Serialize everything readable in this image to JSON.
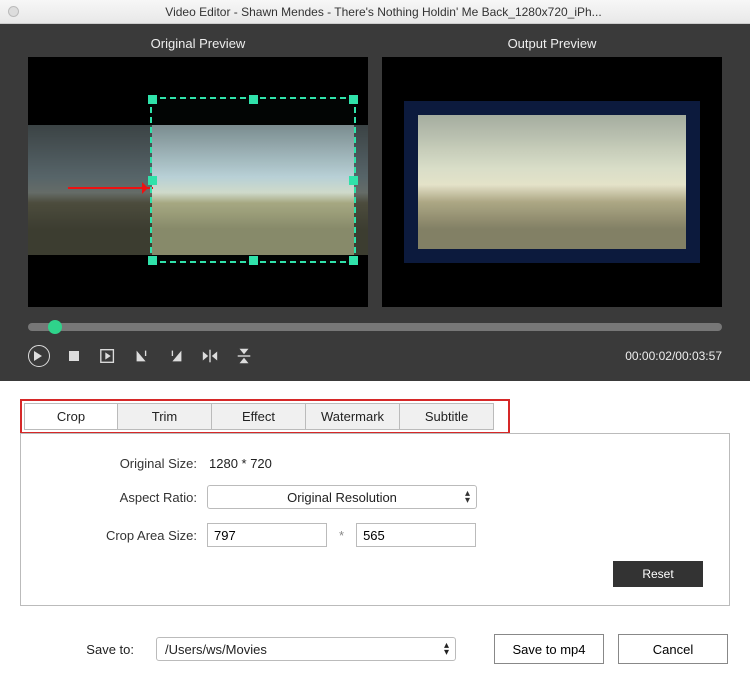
{
  "titlebar": {
    "title": "Video Editor - Shawn Mendes - There's Nothing Holdin' Me Back_1280x720_iPh..."
  },
  "preview": {
    "original_label": "Original Preview",
    "output_label": "Output Preview"
  },
  "playback": {
    "current": "00:00:02",
    "total": "00:03:57",
    "sep": "/"
  },
  "tabs": {
    "items": [
      "Crop",
      "Trim",
      "Effect",
      "Watermark",
      "Subtitle"
    ],
    "active": 0
  },
  "crop_panel": {
    "original_size_label": "Original Size:",
    "original_size_value": "1280 * 720",
    "aspect_ratio_label": "Aspect Ratio:",
    "aspect_ratio_value": "Original Resolution",
    "crop_area_label": "Crop Area Size:",
    "crop_w": "797",
    "crop_h": "565",
    "reset_label": "Reset"
  },
  "footer": {
    "save_to_label": "Save to:",
    "save_to_path": "/Users/ws/Movies",
    "save_mp4_label": "Save to mp4",
    "cancel_label": "Cancel"
  }
}
